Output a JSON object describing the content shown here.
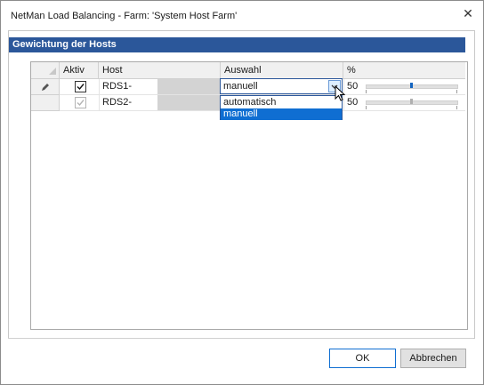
{
  "window": {
    "title": "NetMan Load Balancing - Farm: 'System Host Farm'",
    "close_glyph": "✕"
  },
  "group": {
    "header": "Gewichtung der Hosts"
  },
  "grid": {
    "columns": [
      "Aktiv",
      "Host",
      "Auswahl",
      "%"
    ],
    "rows": [
      {
        "editing": true,
        "aktiv": true,
        "host": "RDS1-",
        "auswahl": "manuell",
        "percent": "50",
        "slider_value": 0.5
      },
      {
        "editing": false,
        "aktiv": true,
        "host": "RDS2-",
        "auswahl": "",
        "percent": "50",
        "slider_value": 0.5
      }
    ]
  },
  "dropdown": {
    "options": [
      "automatisch",
      "manuell"
    ],
    "selected": "manuell"
  },
  "buttons": {
    "ok": "OK",
    "cancel": "Abbrechen"
  },
  "colors": {
    "header_bg": "#2b579a",
    "selection": "#0f6ed2"
  },
  "icons": {
    "edit_row": "pencil-icon",
    "dropdown": "chevron-down-icon",
    "check": "checkmark-icon"
  }
}
